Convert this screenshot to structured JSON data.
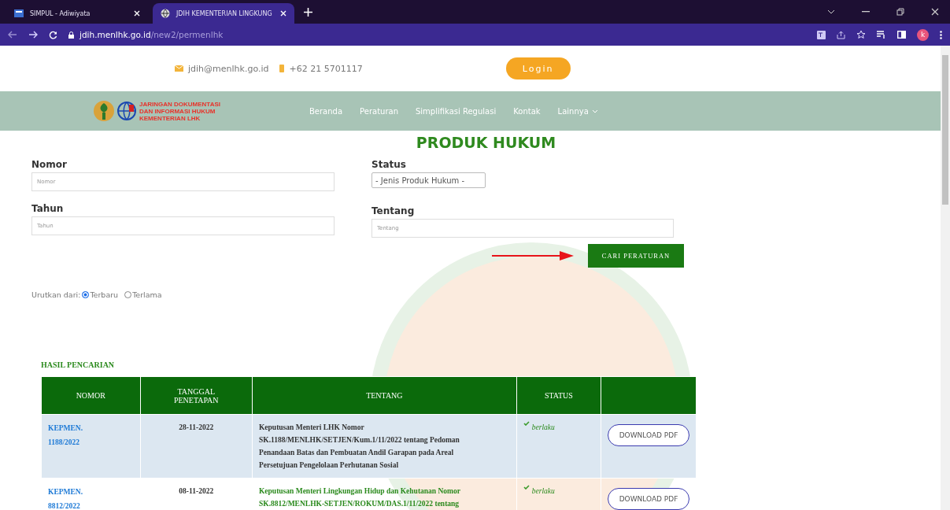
{
  "browser": {
    "tabs": [
      {
        "title": "SIMPUL - Adiwiyata",
        "selected": false
      },
      {
        "title": "JDIH KEMENTERIAN LINGKUNG",
        "selected": true
      }
    ],
    "url_host": "jdih.menlhk.go.id",
    "url_path": "/new2/permenlhk",
    "profile_initial": "k"
  },
  "contact": {
    "email": "jdih@menlhk.go.id",
    "phone": "+62 21 5701117",
    "login": "Login"
  },
  "nav": {
    "logo_lines": [
      "JARINGAN DOKUMENTASI",
      "DAN INFORMASI HUKUM",
      "KEMENTERIAN LHK"
    ],
    "items": [
      {
        "label": "Beranda",
        "dropdown": false
      },
      {
        "label": "Peraturan",
        "dropdown": false
      },
      {
        "label": "Simplifikasi Regulasi",
        "dropdown": false
      },
      {
        "label": "Kontak",
        "dropdown": false
      },
      {
        "label": "Lainnya",
        "dropdown": true
      }
    ]
  },
  "title": "PRODUK HUKUM",
  "form": {
    "nomor": {
      "label": "Nomor",
      "placeholder": "Nomor"
    },
    "status": {
      "label": "Status",
      "value": "- Jenis Produk Hukum -"
    },
    "tahun": {
      "label": "Tahun",
      "placeholder": "Tahun"
    },
    "tentang": {
      "label": "Tentang",
      "placeholder": "Tentang"
    },
    "search_button": "CARI PERATURAN"
  },
  "sort": {
    "label": "Urutkan dari:",
    "options": [
      {
        "label": "Terbaru",
        "selected": true
      },
      {
        "label": "Terlama",
        "selected": false
      }
    ]
  },
  "results": {
    "heading": "HASIL PENCARIAN",
    "columns": [
      "NOMOR",
      "TANGGAL PENETAPAN",
      "TENTANG",
      "STATUS"
    ],
    "rows": [
      {
        "nomor": "KEPMEN. 1188/2022",
        "tanggal": "28-11-2022",
        "tentang": "Keputusan Menteri LHK Nomor SK.1188/MENLHK/SETJEN/Kum.1/11/2022 tentang Pedoman Penandaan Batas dan Pembuatan Andil Garapan pada Areal Persetujuan Pengelolaan Perhutanan Sosial",
        "status": "berlaku",
        "action": "DOWNLOAD PDF",
        "shaded": true,
        "hovered": false
      },
      {
        "nomor": "KEPMEN. 8812/2022",
        "tanggal": "08-11-2022",
        "tentang": "Keputusan Menteri Lingkungan Hidup dan Kehutanan Nomor SK.8812/MENLHK-SETJEN/ROKUM/DAS.1/11/2022 tentang",
        "status": "berlaku",
        "action": "DOWNLOAD PDF",
        "shaded": false,
        "hovered": true
      }
    ]
  }
}
